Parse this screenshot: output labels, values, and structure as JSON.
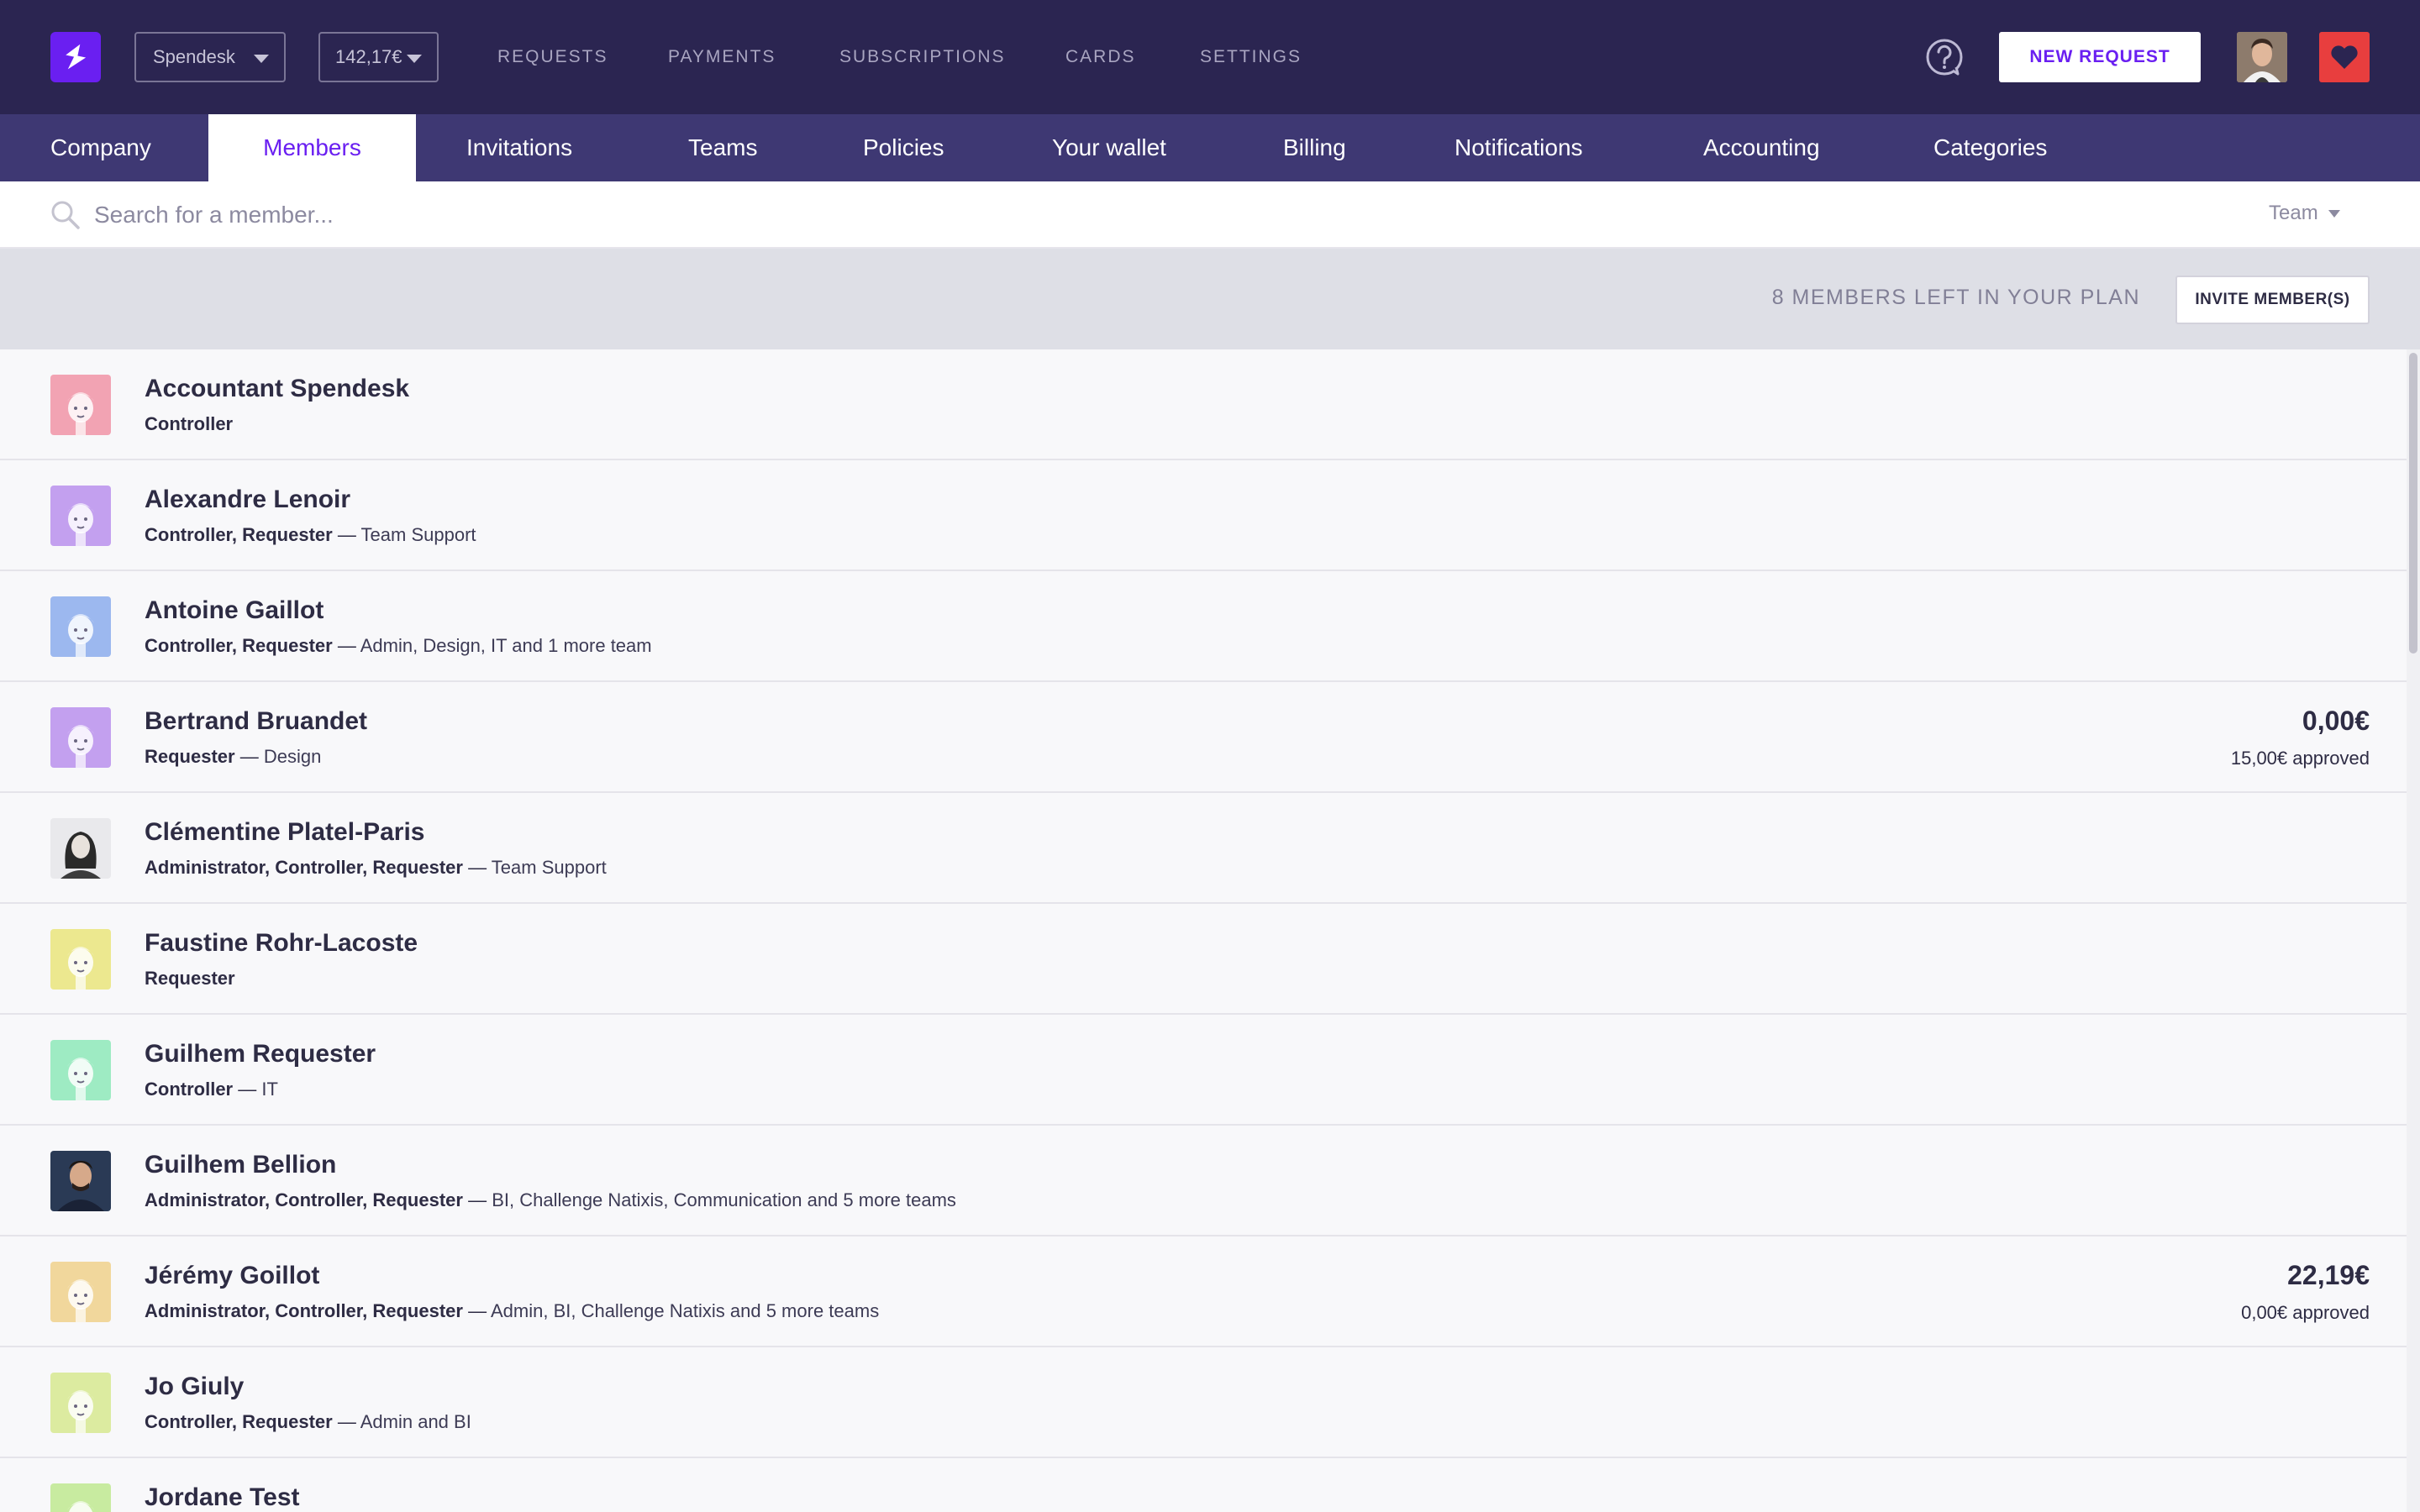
{
  "topbar": {
    "company": "Spendesk",
    "balance": "142,17€",
    "nav": [
      "REQUESTS",
      "PAYMENTS",
      "SUBSCRIPTIONS",
      "CARDS",
      "SETTINGS"
    ],
    "new_request": "NEW REQUEST"
  },
  "subnav": {
    "tabs": [
      "Company",
      "Members",
      "Invitations",
      "Teams",
      "Policies",
      "Your wallet",
      "Billing",
      "Notifications",
      "Accounting",
      "Categories"
    ],
    "active": "Members"
  },
  "search": {
    "placeholder": "Search for a member...",
    "team_filter": "Team"
  },
  "plan": {
    "text": "8 MEMBERS LEFT IN YOUR PLAN",
    "invite_button": "INVITE MEMBER(S)"
  },
  "members": [
    {
      "name": "Accountant Spendesk",
      "roles": "Controller",
      "teams": "",
      "amount": "",
      "approved": "",
      "avatar": "illustration",
      "avatar_color": "#f2a3b3"
    },
    {
      "name": "Alexandre Lenoir",
      "roles": "Controller, Requester",
      "teams": "Team Support",
      "amount": "",
      "approved": "",
      "avatar": "illustration",
      "avatar_color": "#c3a0ef"
    },
    {
      "name": "Antoine Gaillot",
      "roles": "Controller, Requester",
      "teams": "Admin, Design, IT and 1 more team",
      "amount": "",
      "approved": "",
      "avatar": "illustration",
      "avatar_color": "#9cb8ef"
    },
    {
      "name": "Bertrand Bruandet",
      "roles": "Requester",
      "teams": "Design",
      "amount": "0,00€",
      "approved": "15,00€ approved",
      "avatar": "illustration",
      "avatar_color": "#c3a0ef"
    },
    {
      "name": "Clémentine Platel-Paris",
      "roles": "Administrator, Controller, Requester",
      "teams": "Team Support",
      "amount": "",
      "approved": "",
      "avatar": "photo",
      "avatar_color": "#e9e9ec"
    },
    {
      "name": "Faustine Rohr-Lacoste",
      "roles": "Requester",
      "teams": "",
      "amount": "",
      "approved": "",
      "avatar": "illustration",
      "avatar_color": "#ece88f"
    },
    {
      "name": "Guilhem Requester",
      "roles": "Controller",
      "teams": "IT",
      "amount": "",
      "approved": "",
      "avatar": "illustration",
      "avatar_color": "#9eebc3"
    },
    {
      "name": "Guilhem Bellion",
      "roles": "Administrator, Controller, Requester",
      "teams": "BI, Challenge Natixis, Communication and 5 more teams",
      "amount": "",
      "approved": "",
      "avatar": "photo",
      "avatar_color": "#2a3a55"
    },
    {
      "name": "Jérémy Goillot",
      "roles": "Administrator, Controller, Requester",
      "teams": "Admin, BI, Challenge Natixis and 5 more teams",
      "amount": "22,19€",
      "approved": "0,00€ approved",
      "avatar": "illustration",
      "avatar_color": "#f1d79c"
    },
    {
      "name": "Jo Giuly",
      "roles": "Controller, Requester",
      "teams": "Admin and BI",
      "amount": "",
      "approved": "",
      "avatar": "illustration",
      "avatar_color": "#dceba0"
    },
    {
      "name": "Jordane Test",
      "roles": "",
      "teams": "",
      "amount": "",
      "approved": "",
      "avatar": "illustration",
      "avatar_color": "#c8eba0"
    }
  ],
  "colors": {
    "topbar": "#2b2551",
    "subnav": "#3e3873",
    "accent": "#6a1ff1",
    "heart": "#e83e3e"
  },
  "icons": {
    "logo": "spendesk-logo-icon",
    "help": "help-icon",
    "heart": "heart-icon",
    "search": "search-icon"
  }
}
